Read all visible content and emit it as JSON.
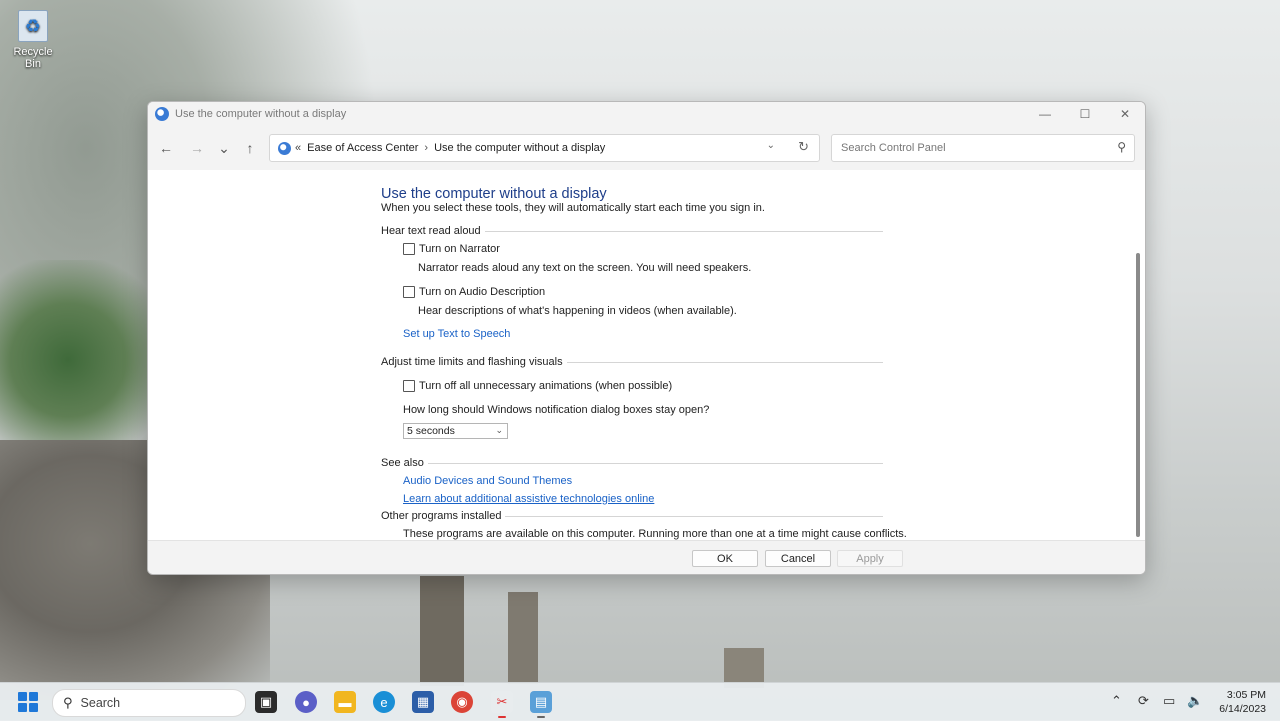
{
  "desktop": {
    "recycle_bin_label": "Recycle Bin"
  },
  "window": {
    "title": "Use the computer without a display",
    "controls": {
      "minimize": "—",
      "maximize": "☐",
      "close": "✕"
    }
  },
  "navigation": {
    "back": "←",
    "forward": "→",
    "recent": "⌄",
    "up": "↑",
    "breadcrumb_overflow": "«",
    "breadcrumb": [
      "Ease of Access Center",
      "Use the computer without a display"
    ],
    "breadcrumb_separator": "›",
    "search_placeholder": "Search Control Panel"
  },
  "content": {
    "page_title": "Use the computer without a display",
    "subtitle": "When you select these tools, they will automatically start each time you sign in.",
    "sections": {
      "hear_text": {
        "label": "Hear text read aloud",
        "narrator_label": "Turn on Narrator",
        "narrator_desc": "Narrator reads aloud any text on the screen. You will need speakers.",
        "audio_desc_label": "Turn on Audio Description",
        "audio_desc_desc": "Hear descriptions of what's happening in videos (when available).",
        "tts_link": "Set up Text to Speech"
      },
      "time_limits": {
        "label": "Adjust time limits and flashing visuals",
        "animations_label": "Turn off all unnecessary animations (when possible)",
        "notification_question": "How long should Windows notification dialog boxes stay open?",
        "notification_value": "5 seconds"
      },
      "see_also": {
        "label": "See also",
        "link1": "Audio Devices and Sound Themes",
        "link2": "Learn about additional assistive technologies online"
      },
      "other_programs": {
        "label": "Other programs installed",
        "desc": "These programs are available on this computer. Running more than one at a time might cause conflicts."
      }
    }
  },
  "footer": {
    "ok": "OK",
    "cancel": "Cancel",
    "apply": "Apply"
  },
  "taskbar": {
    "search_label": "Search",
    "time": "3:05 PM",
    "date": "6/14/2023"
  },
  "colors": {
    "link": "#1a62c7",
    "title": "#1e3e8a",
    "start": "#1f78d8"
  }
}
